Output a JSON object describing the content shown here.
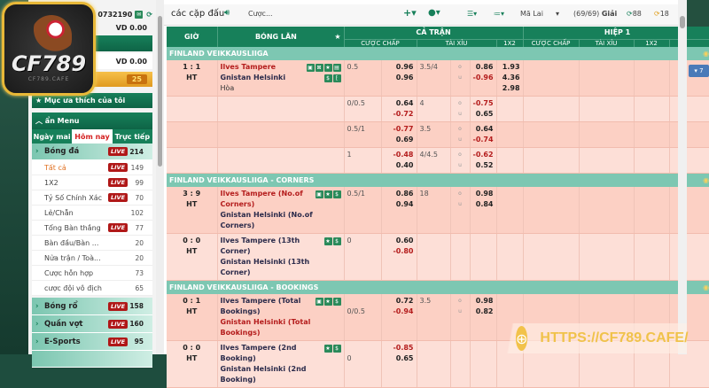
{
  "brand": {
    "logo_text": "CF789",
    "logo_sub": "CF789.CAFE",
    "watermark_url": "HTTPS://CF789.CAFE/"
  },
  "account": {
    "user_id": "0732190",
    "balance1": "VD 0.00",
    "balance2": "VD 0.00",
    "badge": "25"
  },
  "sidebar": {
    "favorites": "Mục ưa thích của tôi",
    "hide_menu": "ẩn Menu",
    "tabs": [
      "Ngày mai",
      "Hôm nay",
      "Trực tiếp"
    ],
    "active_tab": "Hôm nay",
    "sports": [
      {
        "label": "Bóng đá",
        "live": true,
        "count": "214"
      }
    ],
    "sub_items": [
      {
        "label": "Tất cả",
        "live": true,
        "count": "149"
      },
      {
        "label": "1X2",
        "live": true,
        "count": "99"
      },
      {
        "label": "Tỷ Số Chính Xác",
        "live": true,
        "count": "70"
      },
      {
        "label": "Lẻ/Chẵn",
        "live": false,
        "count": "102"
      },
      {
        "label": "Tổng Bàn thắng",
        "live": true,
        "count": "77"
      },
      {
        "label": "Bàn đầu/Bàn ...",
        "live": false,
        "count": "20"
      },
      {
        "label": "Nửa trận / Toà...",
        "live": false,
        "count": "20"
      },
      {
        "label": "Cược hỗn hợp",
        "live": false,
        "count": "73"
      },
      {
        "label": "cược đội vô địch",
        "live": false,
        "count": "65"
      }
    ],
    "other_sports": [
      {
        "label": "Bóng rổ",
        "live": true,
        "count": "158"
      },
      {
        "label": "Quần vợt",
        "live": true,
        "count": "160"
      },
      {
        "label": "E-Sports",
        "live": true,
        "count": "95"
      }
    ],
    "live_label": "LIVE"
  },
  "toolbar": {
    "title": "các cặp đấu",
    "bet_label": "Cược...",
    "odds_type": "Mã Lai",
    "leagues": "(69/69)",
    "leagues_word": "Giải",
    "refresh1": "88",
    "refresh2": "18"
  },
  "table": {
    "headers": {
      "time": "GIỜ",
      "live": "BÓNG LĂN",
      "full": "CẢ TRẬN",
      "half": "HIỆP 1",
      "handicap": "CƯỢC CHẤP",
      "overunder": "TÀI XỈU",
      "x12": "1X2"
    },
    "more_button": "▾ 7",
    "leagues": [
      {
        "name": "FINLAND VEIKKAUSLIIGA",
        "rows": [
          {
            "score": "1 : 1",
            "period": "HT",
            "home": "Ilves Tampere",
            "away": "Gnistan Helsinki",
            "draw": "Hòa",
            "fav": "home",
            "hdp": "0.5",
            "hdp_h": "0.96",
            "hdp_a": "0.96",
            "ou": "3.5/4",
            "ou_o": "0.86",
            "ou_u": "-0.96",
            "x1": "1.93",
            "x2": "4.36",
            "xx": "2.98",
            "icons": 6,
            "more": true
          },
          {
            "hdp": "0/0.5",
            "hdp_h": "0.64",
            "hdp_a": "-0.72",
            "ou": "4",
            "ou_o": "-0.75",
            "ou_u": "0.65"
          },
          {
            "hdp": "0.5/1",
            "hdp_h": "-0.77",
            "hdp_a": "0.69",
            "ou": "3.5",
            "ou_o": "0.64",
            "ou_u": "-0.74"
          },
          {
            "hdp": "1",
            "hdp_h": "-0.48",
            "hdp_a": "0.40",
            "ou": "4/4.5",
            "ou_o": "-0.62",
            "ou_u": "0.52"
          }
        ]
      },
      {
        "name": "FINLAND VEIKKAUSLIIGA - CORNERS",
        "rows": [
          {
            "score": "3 : 9",
            "period": "HT",
            "home": "Ilves Tampere (No.of Corners)",
            "away": "Gnistan Helsinki (No.of Corners)",
            "fav": "home",
            "hdp": "0.5/1",
            "hdp_h": "0.86",
            "hdp_a": "0.94",
            "ou": "18",
            "ou_o": "0.98",
            "ou_u": "0.84",
            "icons": 3
          },
          {
            "score": "0 : 0",
            "period": "HT",
            "home": "Ilves Tampere (13th Corner)",
            "away": "Gnistan Helsinki (13th Corner)",
            "fav": "none",
            "hdp": "0",
            "hdp_h": "0.60",
            "hdp_a": "-0.80",
            "icons": 2
          }
        ]
      },
      {
        "name": "FINLAND VEIKKAUSLIIGA - BOOKINGS",
        "rows": [
          {
            "score": "0 : 1",
            "period": "HT",
            "home": "Ilves Tampere (Total Bookings)",
            "away": "Gnistan Helsinki (Total Bookings)",
            "fav": "away",
            "hdp_away": "0/0.5",
            "hdp_h": "0.72",
            "hdp_a": "-0.94",
            "ou": "3.5",
            "ou_o": "0.98",
            "ou_u": "0.82",
            "icons": 3
          },
          {
            "score": "0 : 0",
            "period": "HT",
            "home": "Ilves Tampere (2nd Booking)",
            "away": "Gnistan Helsinki (2nd Booking)",
            "fav": "none",
            "hdp_away": "0",
            "hdp_h": "-0.85",
            "hdp_a": "0.65",
            "icons": 2
          }
        ]
      }
    ]
  }
}
